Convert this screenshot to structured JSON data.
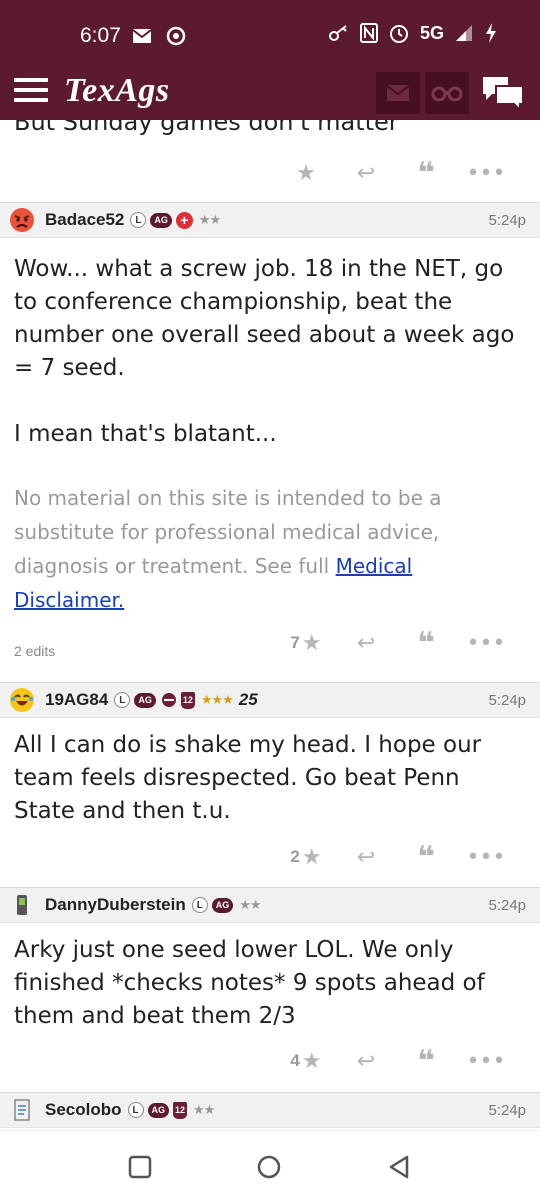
{
  "status": {
    "time": "6:07",
    "network": "5G"
  },
  "app": {
    "title": "TexAgs"
  },
  "partial_post": {
    "text": "But Sunday games don't matter"
  },
  "posts": [
    {
      "username": "Badace52",
      "badges": [
        "L",
        "AG",
        "+"
      ],
      "stars": "★★",
      "time": "5:24p",
      "body_lines": [
        "Wow... what a screw job. 18 in the NET, go to conference championship, beat the number one overall seed about a week ago = 7 seed.",
        "I mean that's blatant..."
      ],
      "disclaimer": "No material on this site is intended to be a substitute for professional medical advice, diagnosis or treatment. See full ",
      "disclaimer_link": "Medical Disclaimer.",
      "edits": "2 edits",
      "likes": "7"
    },
    {
      "username": "19AG84",
      "badges": [
        "L",
        "AG",
        "12"
      ],
      "stars": "★★★",
      "extra": "25",
      "time": "5:24p",
      "body_lines": [
        "All I can do is shake my head. I hope our team feels disrespected. Go beat Penn State and then t.u."
      ],
      "likes": "2"
    },
    {
      "username": "DannyDuberstein",
      "badges": [
        "L",
        "AG"
      ],
      "stars": "★★",
      "time": "5:24p",
      "body_lines": [
        "Arky just one seed lower LOL. We only finished *checks notes* 9 spots ahead of them and beat them 2/3"
      ],
      "likes": "4"
    },
    {
      "username": "Secolobo",
      "badges": [
        "L",
        "AG",
        "12"
      ],
      "stars": "★★",
      "time": "5:24p"
    }
  ],
  "colors": {
    "maroon": "#5c1a2f",
    "link": "#1a3fb3",
    "gold_star": "#d4a017"
  },
  "icons": [
    "menu-icon",
    "mail-icon",
    "binoculars-icon",
    "chat-icon",
    "star-icon",
    "reply-icon",
    "quote-icon",
    "more-icon"
  ]
}
